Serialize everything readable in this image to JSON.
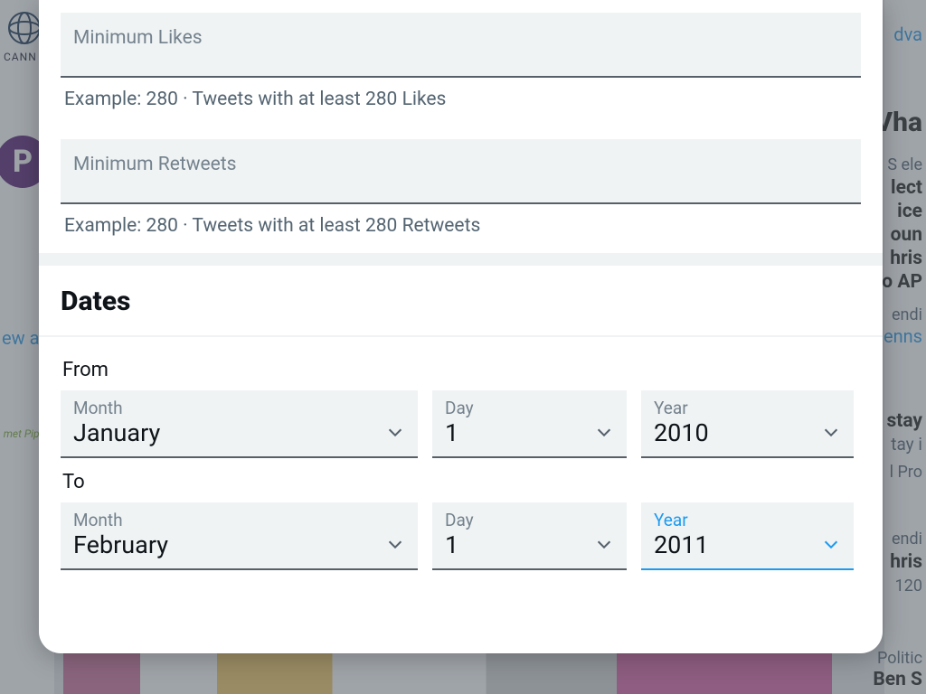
{
  "engagement": {
    "min_likes": {
      "label": "Minimum Likes",
      "hint": "Example: 280 · Tweets with at least 280 Likes"
    },
    "min_retweets": {
      "label": "Minimum Retweets",
      "hint": "Example: 280 · Tweets with at least 280 Retweets"
    }
  },
  "dates": {
    "title": "Dates",
    "from_label": "From",
    "to_label": "To",
    "month_label": "Month",
    "day_label": "Day",
    "year_label": "Year",
    "from": {
      "month": "January",
      "day": "1",
      "year": "2010"
    },
    "to": {
      "month": "February",
      "day": "1",
      "year": "2011"
    }
  },
  "background": {
    "icann": "CANN",
    "p_logo": "P",
    "ew_a": "ew a",
    "pippe": "met Pippe",
    "right": {
      "adva": "dva",
      "wha": "Vha",
      "s_ele": "S ele",
      "lect": "lect",
      "ice": "ice",
      "oun": "oun",
      "hris": "hris",
      "o_ap": "o AP",
      "endi1": "endi",
      "enns": "enns",
      "stay": "stay",
      "tay_i": "tay i",
      "pro": "l Pro",
      "endi2": "endi",
      "hris2": "hris",
      "n120": "120",
      "politic": "Politic",
      "ben": "Ben S"
    }
  }
}
